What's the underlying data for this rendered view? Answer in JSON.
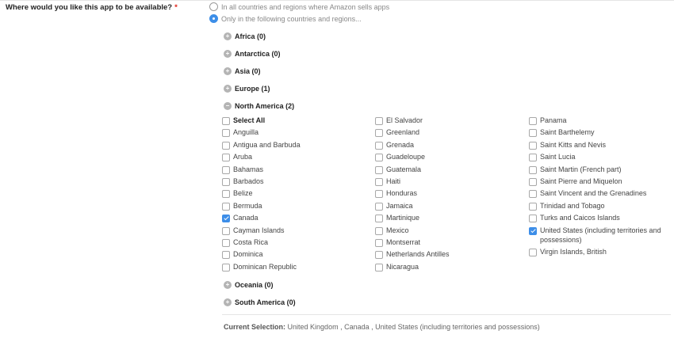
{
  "question": {
    "label": "Where would you like this app to be available?",
    "required_mark": "*"
  },
  "availability": {
    "all_label": "In all countries and regions where Amazon sells apps",
    "only_label": "Only in the following countries and regions...",
    "selected": "only"
  },
  "regions": [
    {
      "name": "Africa (0)",
      "expanded": false,
      "icon": "plus-icon"
    },
    {
      "name": "Antarctica (0)",
      "expanded": false,
      "icon": "plus-icon"
    },
    {
      "name": "Asia (0)",
      "expanded": false,
      "icon": "plus-icon"
    },
    {
      "name": "Europe (1)",
      "expanded": false,
      "icon": "plus-icon"
    },
    {
      "name": "North America (2)",
      "expanded": true,
      "icon": "minus-icon"
    },
    {
      "name": "Oceania (0)",
      "expanded": false,
      "icon": "plus-icon"
    },
    {
      "name": "South America (0)",
      "expanded": false,
      "icon": "plus-icon"
    }
  ],
  "north_america": {
    "select_all_label": "Select All",
    "col0": [
      {
        "name": "Anguilla",
        "checked": false
      },
      {
        "name": "Antigua and Barbuda",
        "checked": false
      },
      {
        "name": "Aruba",
        "checked": false
      },
      {
        "name": "Bahamas",
        "checked": false
      },
      {
        "name": "Barbados",
        "checked": false
      },
      {
        "name": "Belize",
        "checked": false
      },
      {
        "name": "Bermuda",
        "checked": false
      },
      {
        "name": "Canada",
        "checked": true
      },
      {
        "name": "Cayman Islands",
        "checked": false
      },
      {
        "name": "Costa Rica",
        "checked": false
      },
      {
        "name": "Dominica",
        "checked": false
      },
      {
        "name": "Dominican Republic",
        "checked": false
      }
    ],
    "col1": [
      {
        "name": "El Salvador",
        "checked": false
      },
      {
        "name": "Greenland",
        "checked": false
      },
      {
        "name": "Grenada",
        "checked": false
      },
      {
        "name": "Guadeloupe",
        "checked": false
      },
      {
        "name": "Guatemala",
        "checked": false
      },
      {
        "name": "Haiti",
        "checked": false
      },
      {
        "name": "Honduras",
        "checked": false
      },
      {
        "name": "Jamaica",
        "checked": false
      },
      {
        "name": "Martinique",
        "checked": false
      },
      {
        "name": "Mexico",
        "checked": false
      },
      {
        "name": "Montserrat",
        "checked": false
      },
      {
        "name": "Netherlands Antilles",
        "checked": false
      },
      {
        "name": "Nicaragua",
        "checked": false
      }
    ],
    "col2": [
      {
        "name": "Panama",
        "checked": false
      },
      {
        "name": "Saint Barthelemy",
        "checked": false
      },
      {
        "name": "Saint Kitts and Nevis",
        "checked": false
      },
      {
        "name": "Saint Lucia",
        "checked": false
      },
      {
        "name": "Saint Martin (French part)",
        "checked": false
      },
      {
        "name": "Saint Pierre and Miquelon",
        "checked": false
      },
      {
        "name": "Saint Vincent and the Grenadines",
        "checked": false
      },
      {
        "name": "Trinidad and Tobago",
        "checked": false
      },
      {
        "name": "Turks and Caicos Islands",
        "checked": false
      },
      {
        "name": "United States (including territories and possessions)",
        "checked": true
      },
      {
        "name": "Virgin Islands, British",
        "checked": false
      }
    ]
  },
  "current_selection": {
    "label": "Current Selection:",
    "value": "United Kingdom , Canada , United States (including territories and possessions)"
  },
  "colors": {
    "accent": "#3d8ee8",
    "required": "#e1251b",
    "expand_icon": "#b4b4b4"
  }
}
